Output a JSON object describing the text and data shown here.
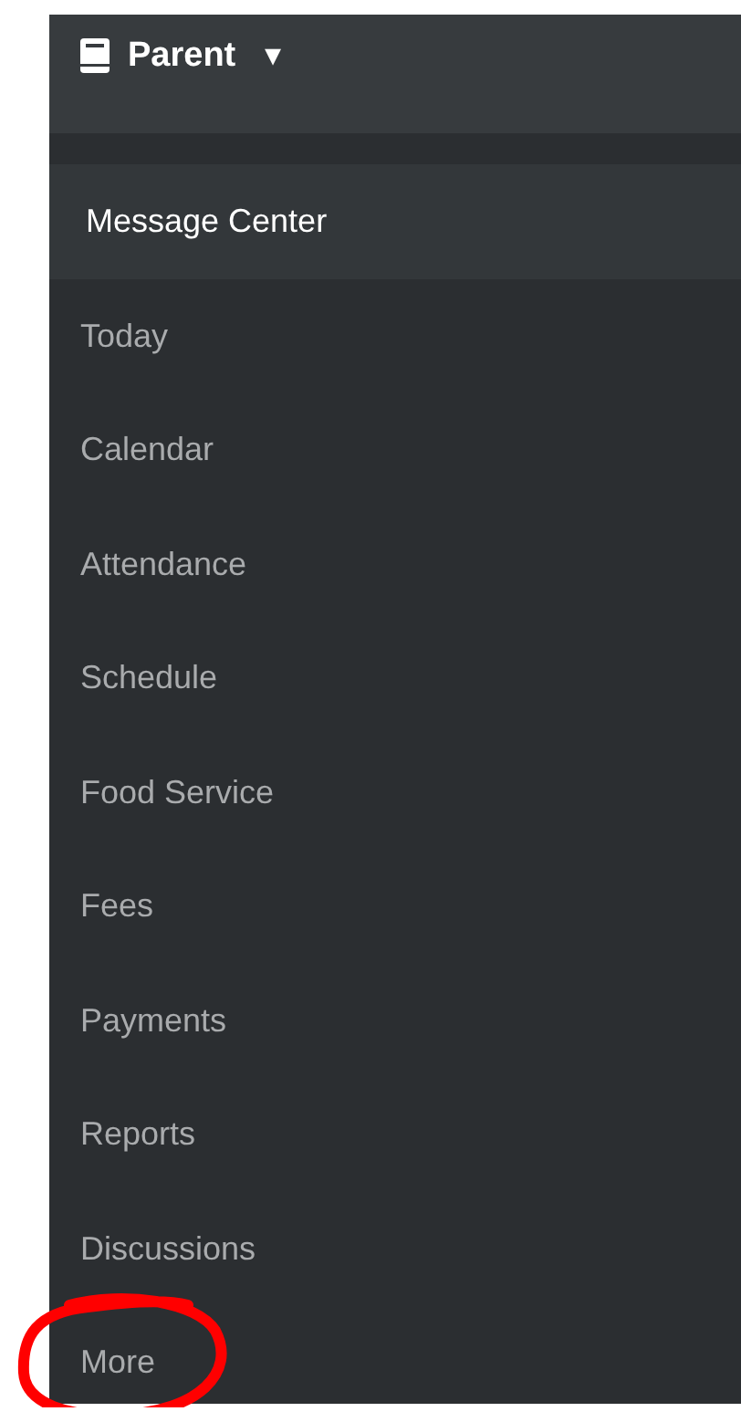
{
  "header": {
    "title": "Parent",
    "caret": "▾"
  },
  "sidebar": {
    "items": [
      {
        "label": "Message Center",
        "selected": true
      },
      {
        "label": "Today",
        "selected": false
      },
      {
        "label": "Calendar",
        "selected": false
      },
      {
        "label": "Attendance",
        "selected": false
      },
      {
        "label": "Schedule",
        "selected": false
      },
      {
        "label": "Food Service",
        "selected": false
      },
      {
        "label": "Fees",
        "selected": false
      },
      {
        "label": "Payments",
        "selected": false
      },
      {
        "label": "Reports",
        "selected": false
      },
      {
        "label": "Discussions",
        "selected": false
      },
      {
        "label": "More",
        "selected": false
      }
    ]
  }
}
